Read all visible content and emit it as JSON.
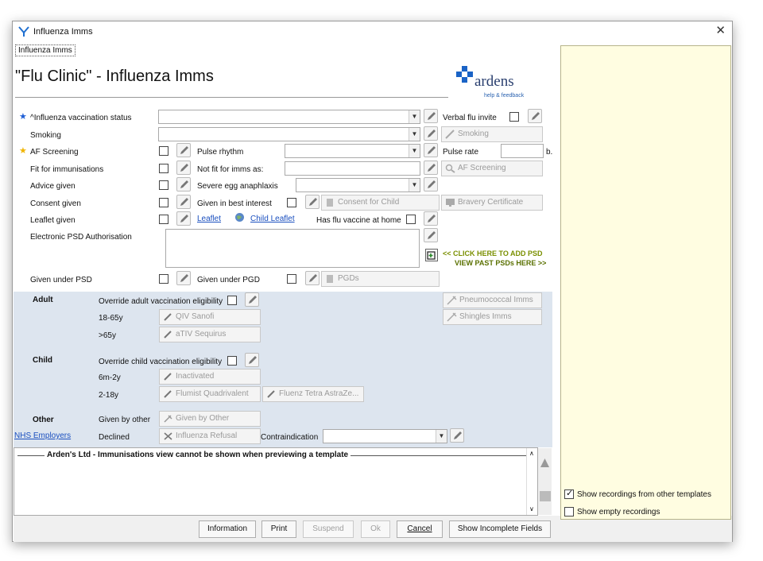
{
  "window": {
    "title": "Influenza Imms",
    "close_icon": "close-icon"
  },
  "tab": "Influenza Imms",
  "form": {
    "heading": "\"Flu Clinic\" - Influenza Imms",
    "logo": {
      "brand": "ardens",
      "tagline": "help & feedback"
    },
    "rows": {
      "vacc_status": "^Influenza vaccination status",
      "smoking": "Smoking",
      "af_screening": "AF Screening",
      "fit_imms": "Fit for immunisations",
      "advice": "Advice given",
      "consent": "Consent given",
      "leaflet": "Leaflet given",
      "psd_auth": "Electronic PSD Authorisation",
      "under_psd": "Given under PSD"
    },
    "mid": {
      "pulse_rhythm": "Pulse rhythm",
      "not_fit": "Not fit for imms as:",
      "severe_egg": "Severe egg anaphlaxis",
      "best_interest": "Given in best interest",
      "leaflet_link": "Leaflet",
      "child_leaflet_link": "Child Leaflet",
      "flu_at_home": "Has flu vaccine at home",
      "under_pgd": "Given under PGD"
    },
    "right": {
      "verbal_invite": "Verbal flu invite",
      "smoking_btn": "Smoking",
      "pulse_rate": "Pulse rate",
      "pulse_unit": "b.",
      "af_btn": "AF Screening",
      "consent_child_btn": "Consent for Child",
      "bravery_btn": "Bravery Certificate",
      "pgds_btn": "PGDs",
      "click_add_psd": "<< CLICK HERE TO ADD PSD",
      "view_past_psd": "VIEW PAST PSDs HERE >>"
    }
  },
  "lower": {
    "adult": {
      "title": "Adult",
      "override": "Override adult vaccination eligibility",
      "age1": "18-65y",
      "btn1": "QIV Sanofi",
      "age2": ">65y",
      "btn2": "aTIV Sequirus"
    },
    "child": {
      "title": "Child",
      "override": "Override child vaccination eligibility",
      "age1": "6m-2y",
      "btn1": "Inactivated",
      "age2": "2-18y",
      "btn2": "Flumist Quadrivalent",
      "btn3": "Fluenz Tetra AstraZe..."
    },
    "other": {
      "title": "Other",
      "given_by_other_lbl": "Given by other",
      "given_by_other_btn": "Given by Other",
      "nhs_link": "NHS Employers",
      "declined": "Declined",
      "refusal_btn": "Influenza Refusal",
      "contraindication": "Contraindication"
    },
    "pneumo_btn": "Pneumococcal Imms",
    "shingles_btn": "Shingles Imms"
  },
  "message": "Arden's Ltd - Immunisations view cannot be shown when previewing a template",
  "buttons": {
    "information": "Information",
    "print": "Print",
    "suspend": "Suspend",
    "ok": "Ok",
    "cancel": "Cancel",
    "incomplete": "Show Incomplete Fields"
  },
  "side": {
    "show_other": "Show recordings from other templates",
    "show_empty": "Show empty recordings"
  },
  "colors": {
    "lower_panel": "#dde5ef",
    "side_panel": "#fffde1",
    "link": "#1a4fbf",
    "psd_link": "#7a8f00",
    "star_blue": "#1f5fd6",
    "star_yellow": "#f0b400"
  }
}
